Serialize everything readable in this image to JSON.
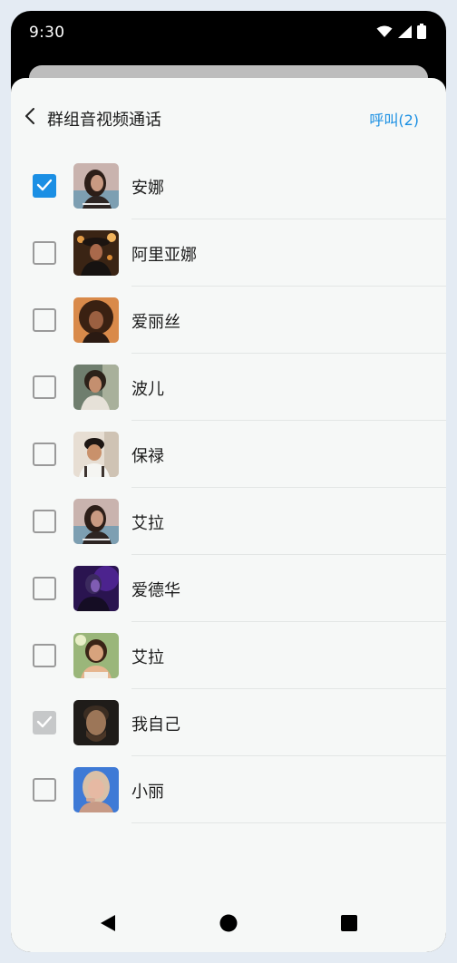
{
  "status_bar": {
    "time": "9:30"
  },
  "header": {
    "title": "群组音视频通话",
    "call_label": "呼叫(2)",
    "back_icon": "chevron-left-icon"
  },
  "contacts": [
    {
      "name": "安娜",
      "state": "checked"
    },
    {
      "name": "阿里亚娜",
      "state": "unchecked"
    },
    {
      "name": "爱丽丝",
      "state": "unchecked"
    },
    {
      "name": "波儿",
      "state": "unchecked"
    },
    {
      "name": "保禄",
      "state": "unchecked"
    },
    {
      "name": "艾拉",
      "state": "unchecked"
    },
    {
      "name": "爱德华",
      "state": "unchecked"
    },
    {
      "name": "艾拉",
      "state": "unchecked"
    },
    {
      "name": "我自己",
      "state": "disabled-checked"
    },
    {
      "name": "小丽",
      "state": "unchecked"
    }
  ],
  "colors": {
    "accent": "#1b8fe4",
    "disabled_check": "#c6c8c9",
    "sheet_bg": "#f6f8f7"
  },
  "nav_bar": {
    "back_icon": "triangle-back-icon",
    "home_icon": "circle-home-icon",
    "recents_icon": "square-recents-icon"
  }
}
